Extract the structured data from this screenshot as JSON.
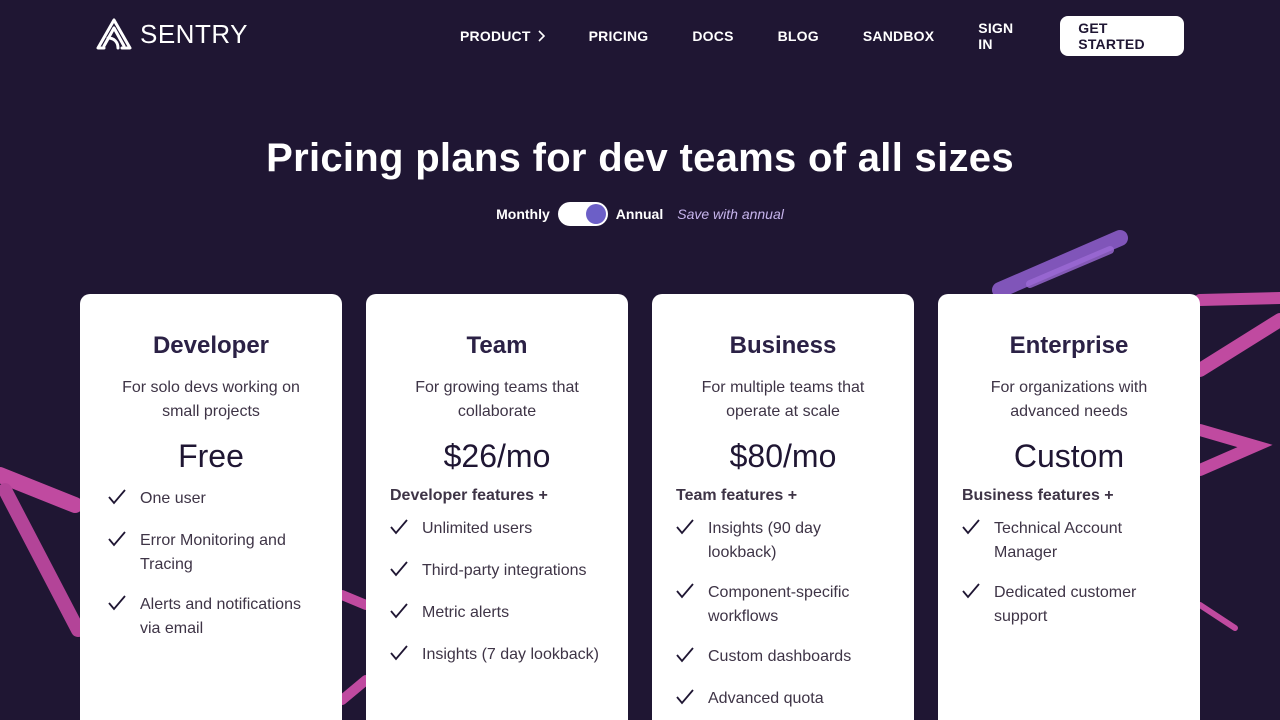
{
  "brand": {
    "name": "SENTRY"
  },
  "nav": {
    "items": [
      "PRODUCT",
      "PRICING",
      "DOCS",
      "BLOG",
      "SANDBOX",
      "SIGN IN"
    ],
    "cta": "GET STARTED"
  },
  "hero": {
    "title": "Pricing plans for dev teams of all sizes",
    "monthly": "Monthly",
    "annual": "Annual",
    "save": "Save with annual",
    "annual_selected": true
  },
  "plans": [
    {
      "name": "Developer",
      "desc": "For solo devs working on small projects",
      "price": "Free",
      "base": "",
      "features": [
        "One user",
        "Error Monitoring and Tracing",
        "Alerts and notifications via email"
      ]
    },
    {
      "name": "Team",
      "desc": "For growing teams that collaborate",
      "price": "$26/mo",
      "base": "Developer features +",
      "features": [
        "Unlimited users",
        "Third-party integrations",
        "Metric alerts",
        "Insights (7 day lookback)"
      ]
    },
    {
      "name": "Business",
      "desc": "For multiple teams that operate at scale",
      "price": "$80/mo",
      "base": "Team features +",
      "features": [
        "Insights (90 day lookback)",
        "Component-specific workflows",
        "Custom dashboards",
        "Advanced quota"
      ]
    },
    {
      "name": "Enterprise",
      "desc": "For organizations with advanced needs",
      "price": "Custom",
      "base": "Business features +",
      "features": [
        "Technical Account Manager",
        "Dedicated customer support"
      ]
    }
  ],
  "colors": {
    "background": "#1f1633",
    "accent": "#6c5fc7",
    "save": "#c6b4ec"
  }
}
